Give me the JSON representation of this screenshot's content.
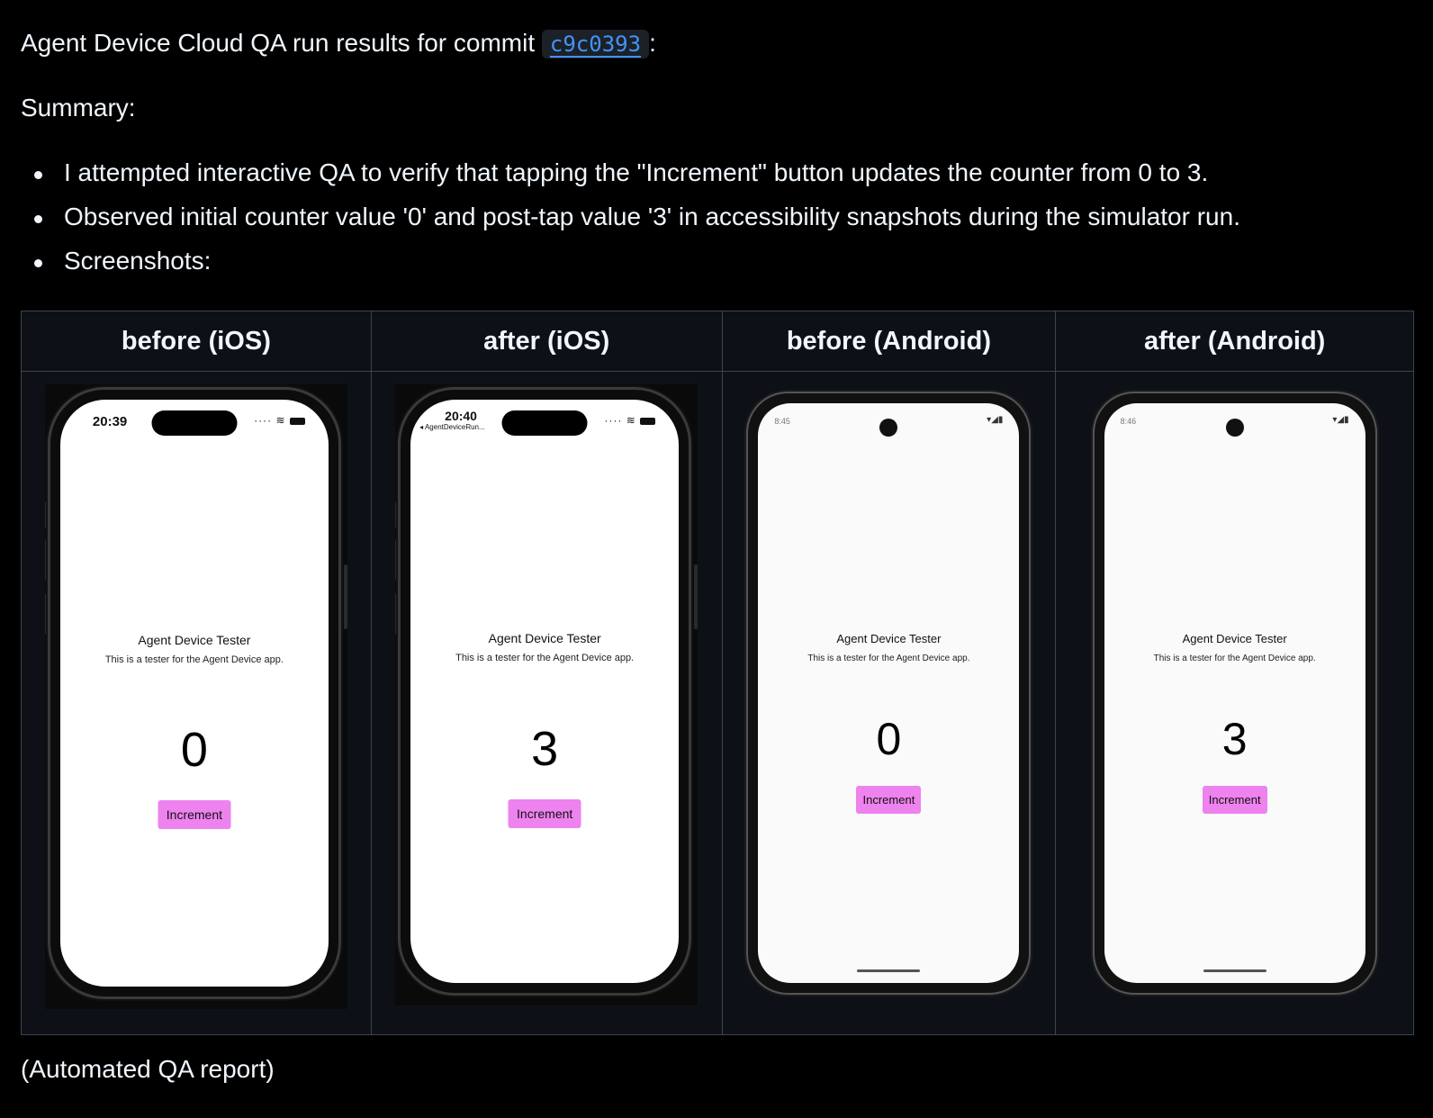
{
  "message": {
    "intro_text": "Agent Device Cloud QA run results for commit",
    "commit_hash": "c9c0393",
    "intro_suffix": ":",
    "summary_heading": "Summary:",
    "bullets": [
      "I attempted interactive QA to verify that tapping the \"Increment\" button updates the counter from 0 to 3.",
      "Observed initial counter value '0' and post-tap value '3' in accessibility snapshots during the simulator run.",
      "Screenshots:"
    ],
    "footer": "(Automated QA report)"
  },
  "screenshots_table": {
    "headers": [
      "before (iOS)",
      "after (iOS)",
      "before (Android)",
      "after (Android)"
    ]
  },
  "devices": [
    {
      "platform": "iOS",
      "status_time": "20:39",
      "back_label": "",
      "app_title": "Agent Device Tester",
      "app_description": "This is a tester for the Agent Device app.",
      "counter_value": "0",
      "button_label": "Increment"
    },
    {
      "platform": "iOS",
      "status_time": "20:40",
      "back_label": "◂ AgentDeviceRun...",
      "app_title": "Agent Device Tester",
      "app_description": "This is a tester for the Agent Device app.",
      "counter_value": "3",
      "button_label": "Increment"
    },
    {
      "platform": "Android",
      "status_time": "8:45",
      "app_title": "Agent Device Tester",
      "app_description": "This is a tester for the Agent Device app.",
      "counter_value": "0",
      "button_label": "Increment"
    },
    {
      "platform": "Android",
      "status_time": "8:46",
      "app_title": "Agent Device Tester",
      "app_description": "This is a tester for the Agent Device app.",
      "counter_value": "3",
      "button_label": "Increment"
    }
  ],
  "icons": {
    "ios_status": [
      "signal-dots-icon",
      "wifi-icon",
      "battery-icon"
    ],
    "android_status": [
      "wifi-icon",
      "cell-signal-icon",
      "battery-icon"
    ]
  },
  "colors": {
    "background": "#000000",
    "link": "#4493f8",
    "table_background": "#0d1117",
    "table_border": "#3d444d",
    "increment_button": "#ee82ee"
  }
}
